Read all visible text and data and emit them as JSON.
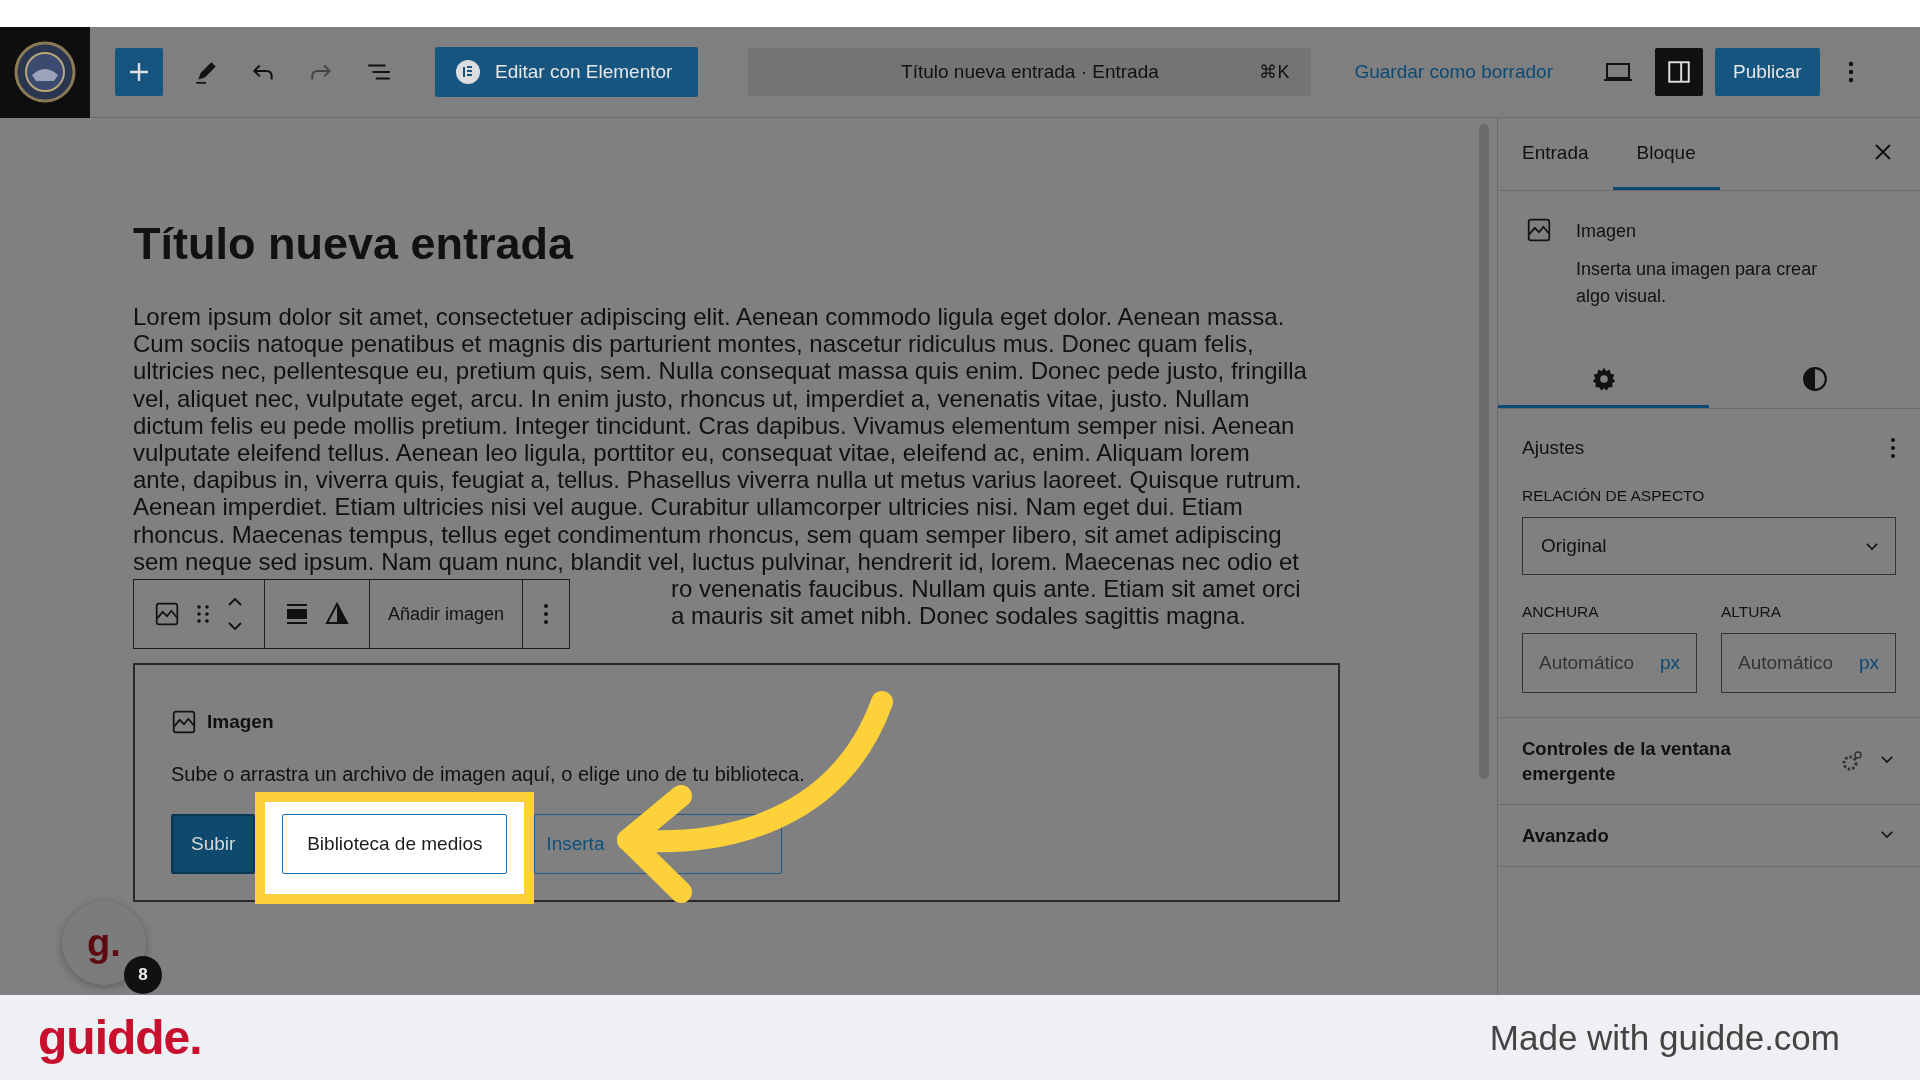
{
  "topbar": {
    "elementor_button": "Editar con Elementor",
    "command": {
      "title": "Título nueva entrada · Entrada",
      "shortcut": "⌘K"
    },
    "save_draft": "Guardar como borrador",
    "sidebar_toggle_on": true,
    "publish": "Publicar"
  },
  "editor": {
    "title": "Título nueva entrada",
    "paragraph": "Lorem ipsum dolor sit amet, consectetuer adipiscing elit. Aenean commodo ligula eget dolor. Aenean massa.\nCum sociis natoque penatibus et magnis dis parturient montes, nascetur ridiculus mus. Donec quam felis,\nultricies nec, pellentesque eu, pretium quis, sem. Nulla consequat massa quis enim. Donec pede justo, fringilla\nvel, aliquet nec, vulputate eget, arcu. In enim justo, rhoncus ut, imperdiet a, venenatis vitae, justo. Nullam\ndictum felis eu pede mollis pretium. Integer tincidunt. Cras dapibus. Vivamus elementum semper nisi. Aenean\nvulputate eleifend tellus. Aenean leo ligula, porttitor eu, consequat vitae, eleifend ac, enim. Aliquam lorem\nante, dapibus in, viverra quis, feugiat a, tellus. Phasellus viverra nulla ut metus varius laoreet. Quisque rutrum.\nAenean imperdiet. Etiam ultricies nisi vel augue. Curabitur ullamcorper ultricies nisi. Nam eget dui. Etiam\nrhoncus. Maecenas tempus, tellus eget condimentum rhoncus, sem quam semper libero, sit amet adipiscing\nsem neque sed ipsum. Nam quam nunc, blandit vel, luctus pulvinar, hendrerit id, lorem. Maecenas nec odio et",
    "paragraph_tail": [
      "ro venenatis faucibus. Nullam quis ante. Etiam sit amet orci",
      "a mauris sit amet nibh. Donec sodales sagittis magna."
    ]
  },
  "block_toolbar": {
    "replace_label": "Añadir imagen"
  },
  "image_block": {
    "title": "Imagen",
    "instructions": "Sube o arrastra un archivo de imagen aquí, o elige uno de tu biblioteca.",
    "buttons": [
      {
        "label": "Subir",
        "kind": "primary"
      },
      {
        "label": "Biblioteca de medios",
        "kind": "highlighted"
      },
      {
        "label": "Inserta",
        "kind": "secondary"
      }
    ]
  },
  "sidebar": {
    "tabs": [
      {
        "label": "Entrada",
        "selected": false
      },
      {
        "label": "Bloque",
        "selected": true
      }
    ],
    "block_card": {
      "title": "Imagen",
      "description": "Inserta una imagen para crear algo visual."
    },
    "subtabs": [
      {
        "kind": "settings",
        "selected": true
      },
      {
        "kind": "styles",
        "selected": false
      }
    ],
    "settings": {
      "title": "Ajustes",
      "aspect_label": "RELACIÓN DE ASPECTO",
      "aspect_value": "Original",
      "width_label": "ANCHURA",
      "width_placeholder": "Automático",
      "width_unit": "px",
      "height_label": "ALTURA",
      "height_placeholder": "Automático",
      "height_unit": "px"
    },
    "panels": [
      {
        "title": "Controles de la ventana emergente",
        "kind": "with-icon",
        "expanded": false
      },
      {
        "title": "Avanzado",
        "kind": "plain",
        "expanded": false
      }
    ]
  },
  "guidde": {
    "badge_letter": "g.",
    "count": "8",
    "brand": "guidde.",
    "footer": "Made with guidde.com"
  }
}
